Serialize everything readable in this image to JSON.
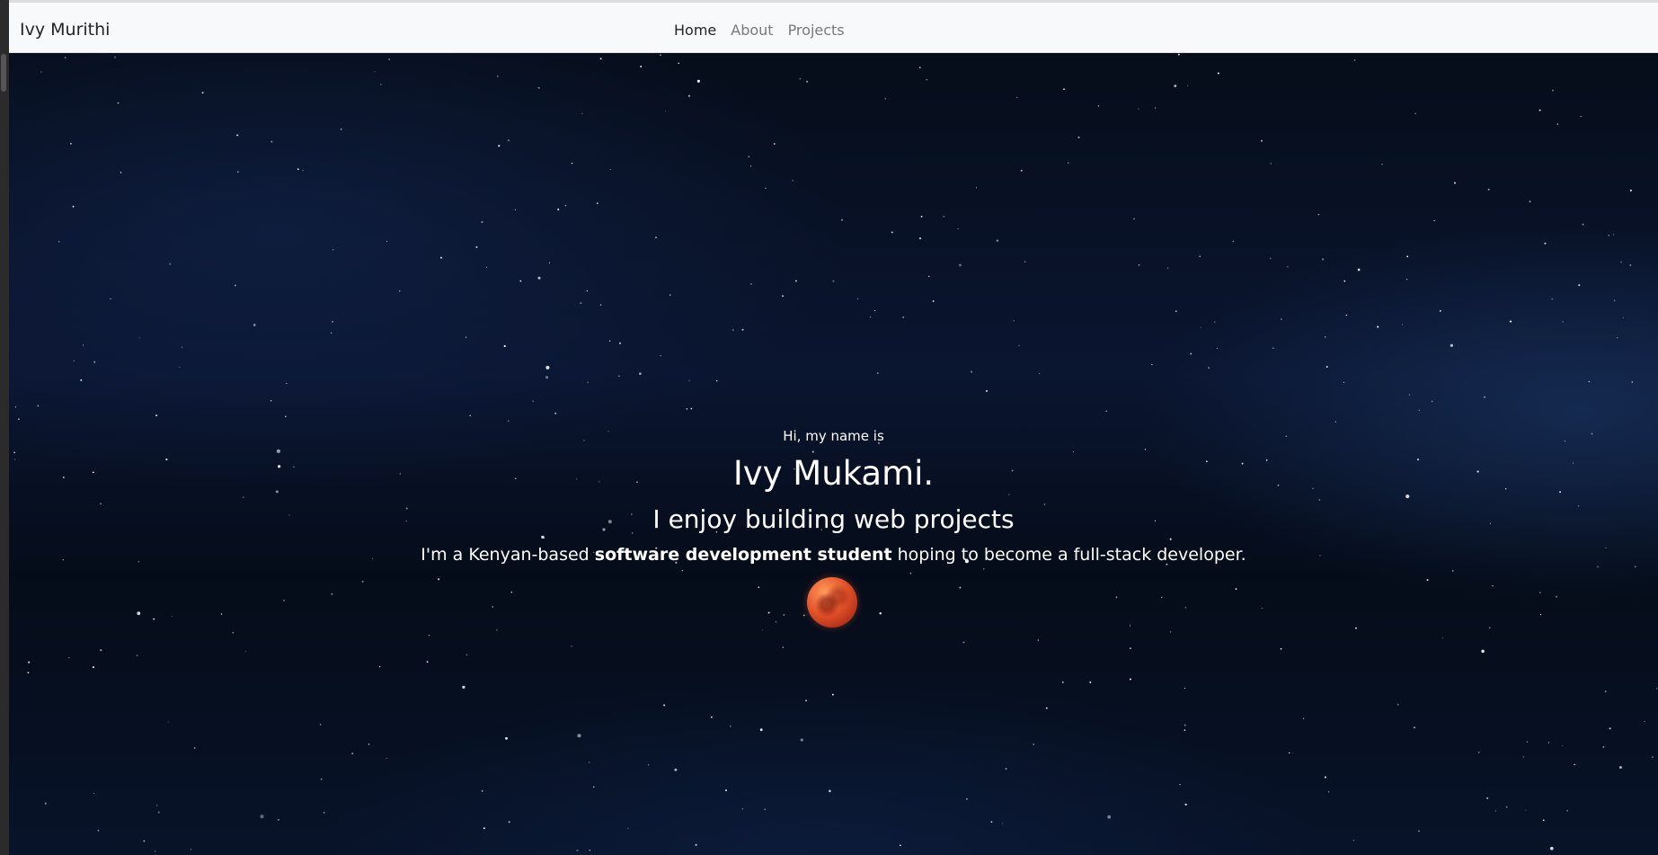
{
  "navbar": {
    "brand": "Ivy Murithi",
    "links": [
      {
        "label": "Home",
        "active": true
      },
      {
        "label": "About",
        "active": false
      },
      {
        "label": "Projects",
        "active": false
      }
    ]
  },
  "hero": {
    "greeting": "Hi, my name is",
    "name": "Ivy Mukami.",
    "tagline": "I enjoy building web projects",
    "intro_before": "I'm a Kenyan-based ",
    "intro_bold": "software development student",
    "intro_after": " hoping to become a full-stack developer."
  },
  "colors": {
    "navbar_bg": "#f8f9fa",
    "hero_bg": "#0a1530",
    "text_light": "#ffffff",
    "moon": "#e5542a"
  },
  "icons": {
    "moon": "blood-moon-icon"
  }
}
